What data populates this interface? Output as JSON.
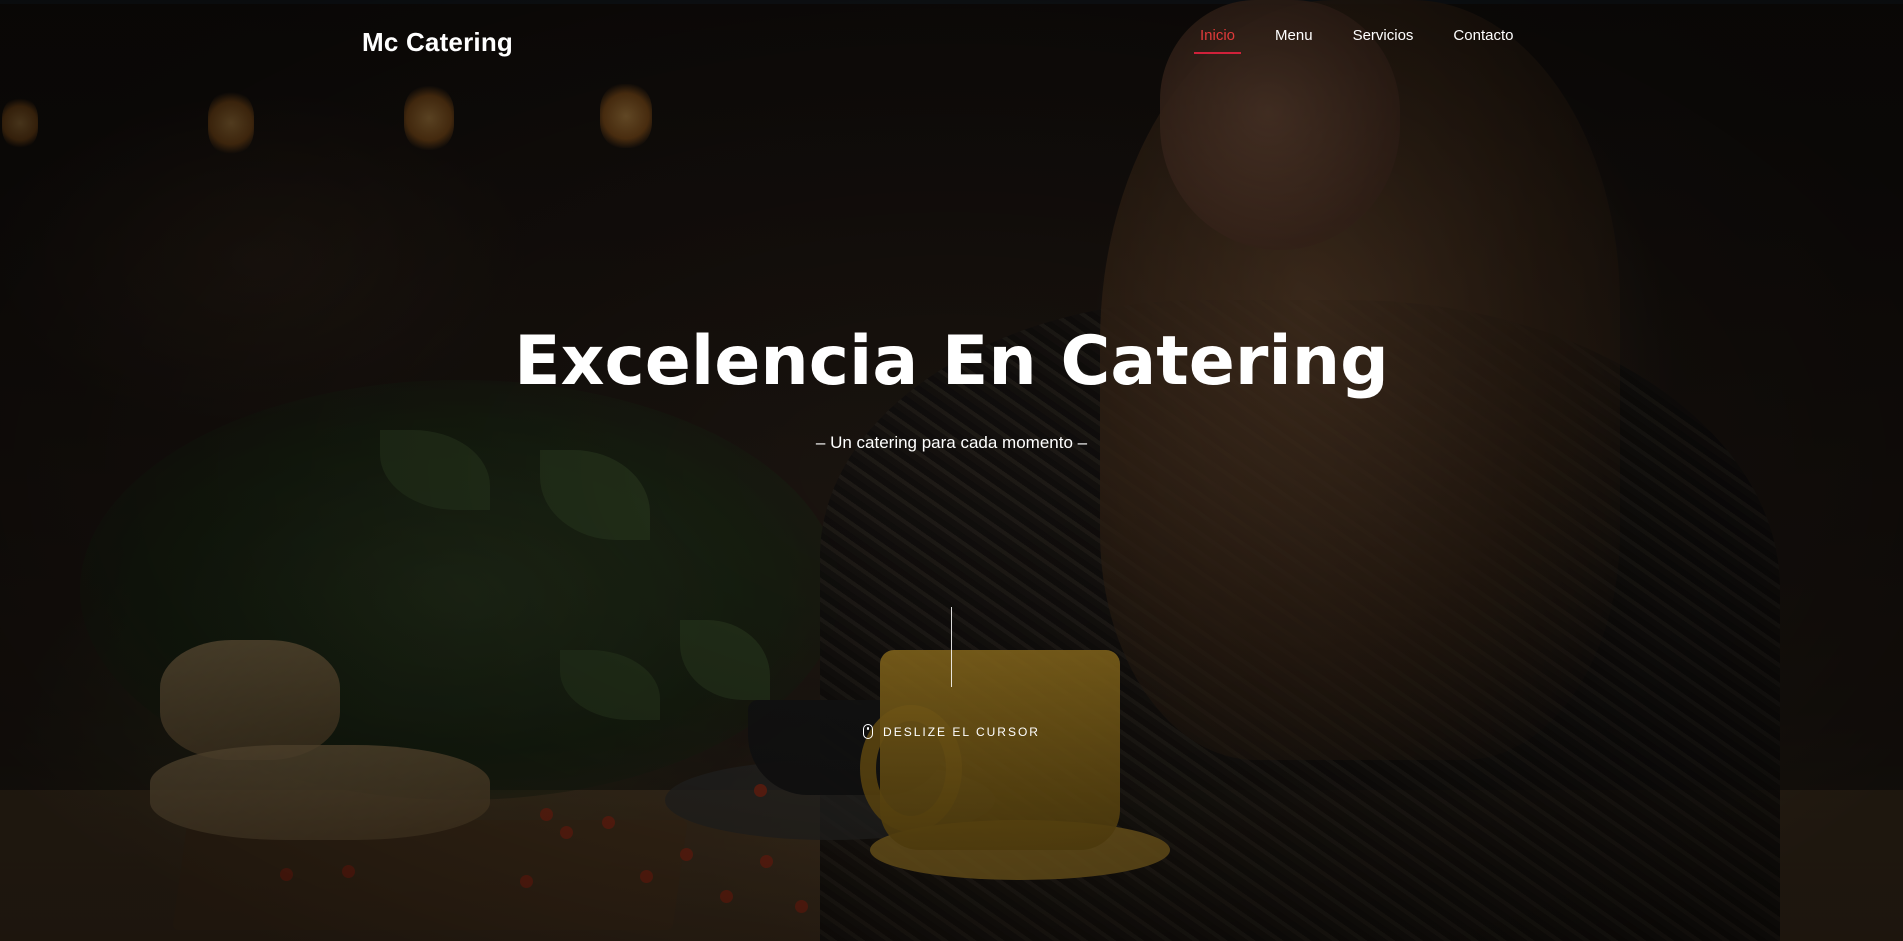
{
  "header": {
    "brand": "Mc Catering",
    "nav": [
      {
        "label": "Inicio",
        "active": true
      },
      {
        "label": "Menu",
        "active": false
      },
      {
        "label": "Servicios",
        "active": false
      },
      {
        "label": "Contacto",
        "active": false
      }
    ]
  },
  "hero": {
    "title": "Excelencia En Catering",
    "subtitle": "– Un catering para cada momento –",
    "scroll_hint": "DESLIZE EL CURSOR",
    "scroll_icon": "mouse-icon"
  },
  "colors": {
    "accent": "#d0213a",
    "text": "#ffffff"
  }
}
